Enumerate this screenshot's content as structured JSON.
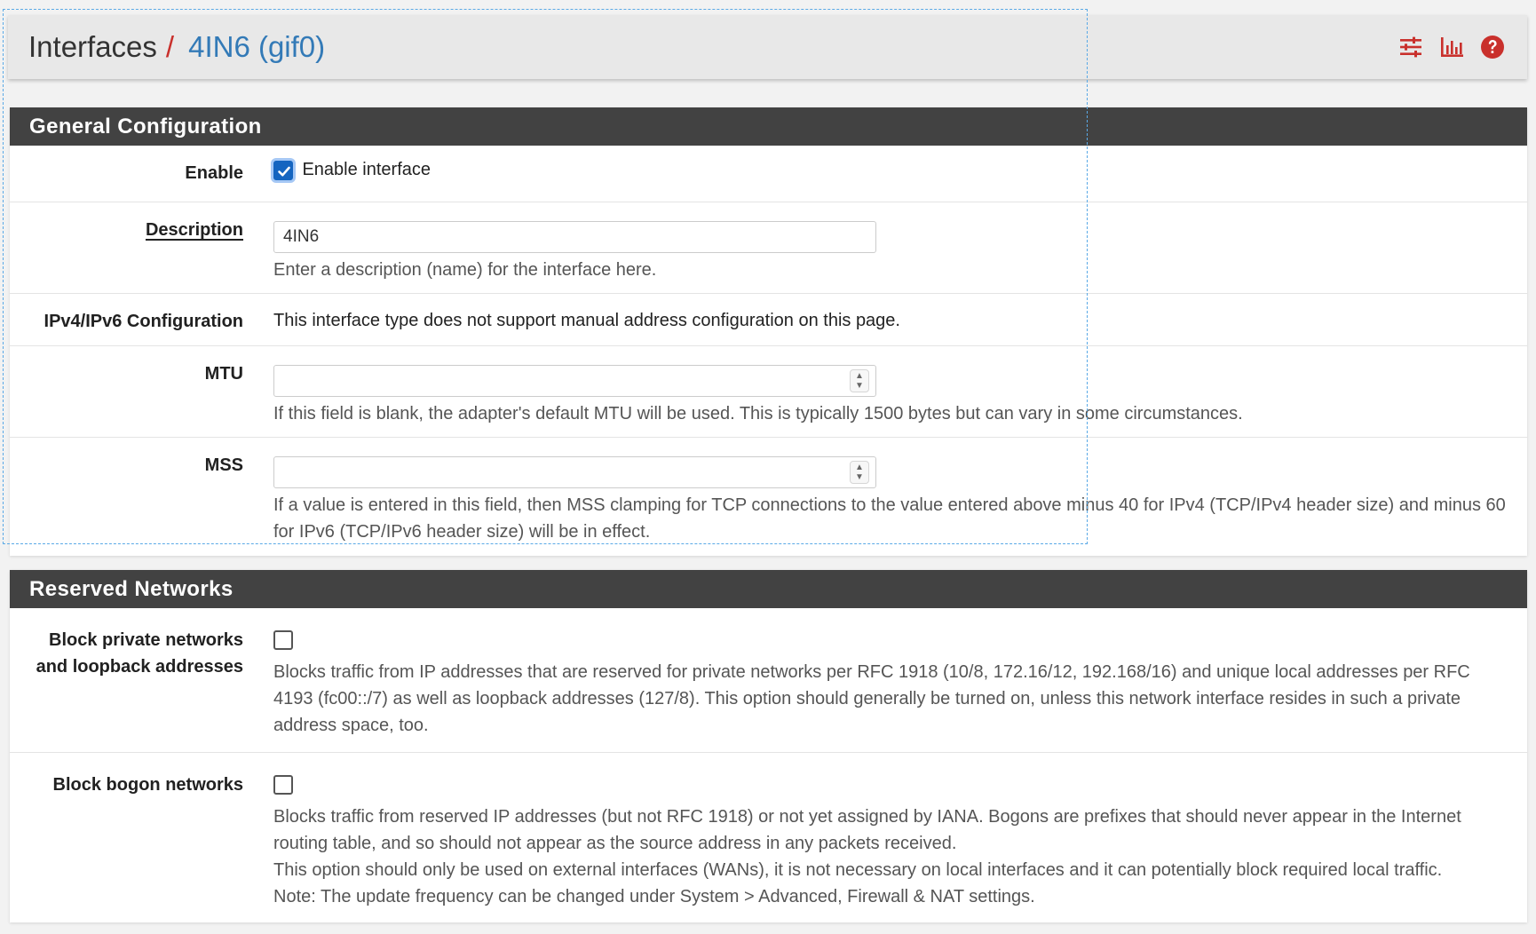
{
  "breadcrumb": {
    "root": "Interfaces",
    "separator": "/",
    "current": "4IN6 (gif0)"
  },
  "header_icons": [
    "sliders-icon",
    "bar-chart-icon",
    "help-icon"
  ],
  "colors": {
    "accent_red": "#c9302c",
    "link_blue": "#337ab7",
    "panel_heading": "#424242",
    "checkbox_blue": "#1565c0"
  },
  "general": {
    "heading": "General Configuration",
    "enable": {
      "label": "Enable",
      "checkbox_label": "Enable interface",
      "checked": true
    },
    "description": {
      "label": "Description",
      "value": "4IN6",
      "help": "Enter a description (name) for the interface here."
    },
    "ipconfig": {
      "label": "IPv4/IPv6 Configuration",
      "text": "This interface type does not support manual address configuration on this page."
    },
    "mtu": {
      "label": "MTU",
      "value": "",
      "help": "If this field is blank, the adapter's default MTU will be used. This is typically 1500 bytes but can vary in some circumstances."
    },
    "mss": {
      "label": "MSS",
      "value": "",
      "help": "If a value is entered in this field, then MSS clamping for TCP connections to the value entered above minus 40 for IPv4 (TCP/IPv4 header size) and minus 60 for IPv6 (TCP/IPv6 header size) will be in effect."
    }
  },
  "reserved": {
    "heading": "Reserved Networks",
    "block_private": {
      "label": "Block private networks and loopback addresses",
      "checked": false,
      "help": "Blocks traffic from IP addresses that are reserved for private networks per RFC 1918 (10/8, 172.16/12, 192.168/16) and unique local addresses per RFC 4193 (fc00::/7) as well as loopback addresses (127/8). This option should generally be turned on, unless this network interface resides in such a private address space, too."
    },
    "block_bogon": {
      "label": "Block bogon networks",
      "checked": false,
      "help_1": "Blocks traffic from reserved IP addresses (but not RFC 1918) or not yet assigned by IANA. Bogons are prefixes that should never appear in the Internet routing table, and so should not appear as the source address in any packets received.",
      "help_2": "This option should only be used on external interfaces (WANs), it is not necessary on local interfaces and it can potentially block required local traffic.",
      "help_3": "Note: The update frequency can be changed under System > Advanced, Firewall & NAT settings."
    }
  }
}
